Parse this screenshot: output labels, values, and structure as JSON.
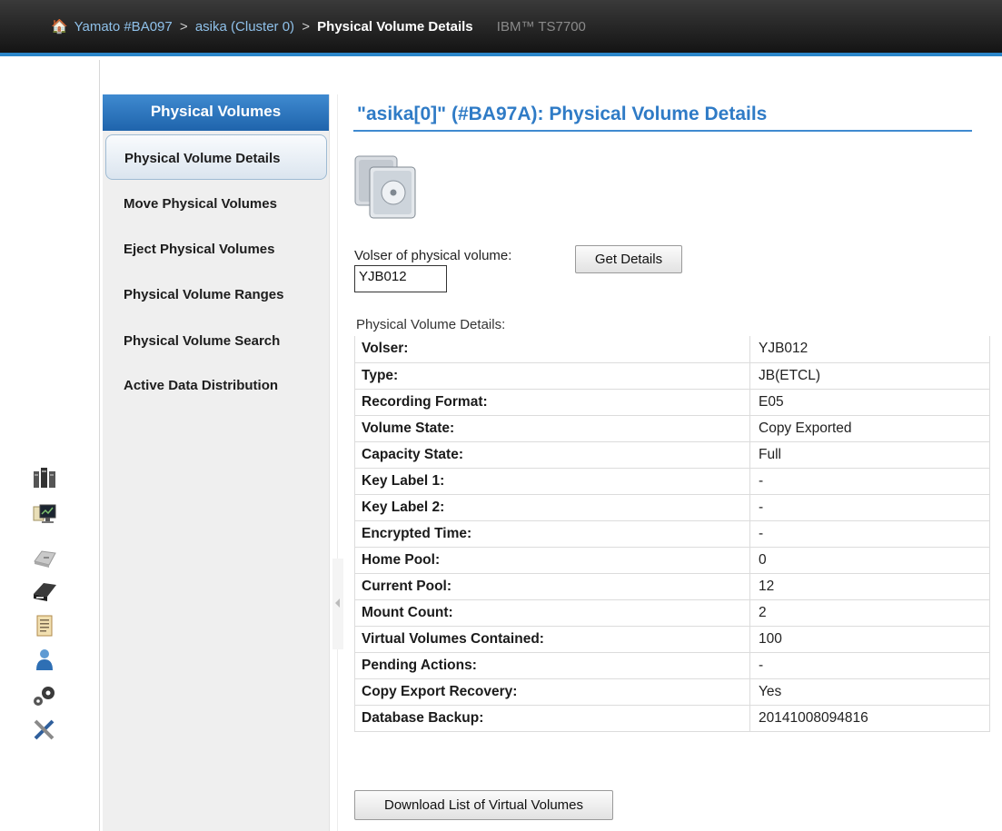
{
  "breadcrumb": {
    "items": [
      "Yamato #BA097",
      "asika (Cluster 0)"
    ],
    "separator": ">",
    "current": "Physical Volume Details",
    "product": "IBM™ TS7700"
  },
  "nav": {
    "header": "Physical Volumes",
    "items": [
      {
        "label": "Physical Volume Details",
        "active": true
      },
      {
        "label": "Move Physical Volumes"
      },
      {
        "label": "Eject Physical Volumes"
      },
      {
        "label": "Physical Volume Ranges"
      },
      {
        "label": "Physical Volume Search"
      },
      {
        "label": "Active Data Distribution"
      }
    ]
  },
  "rail": {
    "icons": [
      "cluster-icon",
      "monitor-icon",
      "virtual-drive-icon",
      "physical-drive-icon",
      "logs-icon",
      "user-icon",
      "settings-gears-icon",
      "service-tools-icon"
    ]
  },
  "main": {
    "title": "\"asika[0]\" (#BA97A): Physical Volume Details",
    "volser_label": "Volser of physical volume:",
    "volser_value": "YJB012",
    "get_details_label": "Get Details",
    "details_caption": "Physical Volume Details:",
    "details": [
      {
        "key": "Volser:",
        "value": "YJB012"
      },
      {
        "key": "Type:",
        "value": "JB(ETCL)"
      },
      {
        "key": "Recording Format:",
        "value": "E05"
      },
      {
        "key": "Volume State:",
        "value": "Copy Exported"
      },
      {
        "key": "Capacity State:",
        "value": "Full"
      },
      {
        "key": "Key Label 1:",
        "value": "-"
      },
      {
        "key": "Key Label 2:",
        "value": "-"
      },
      {
        "key": "Encrypted Time:",
        "value": "-"
      },
      {
        "key": "Home Pool:",
        "value": "0"
      },
      {
        "key": "Current Pool:",
        "value": "12"
      },
      {
        "key": "Mount Count:",
        "value": "2"
      },
      {
        "key": "Virtual Volumes Contained:",
        "value": "100"
      },
      {
        "key": "Pending Actions:",
        "value": "-"
      },
      {
        "key": "Copy Export Recovery:",
        "value": "Yes"
      },
      {
        "key": "Database Backup:",
        "value": "20141008094816"
      }
    ],
    "download_label": "Download List of Virtual Volumes"
  },
  "colors": {
    "accent": "#2f7bc6",
    "header_bar": "#1a1a1a",
    "nav_bg": "#efefef"
  }
}
